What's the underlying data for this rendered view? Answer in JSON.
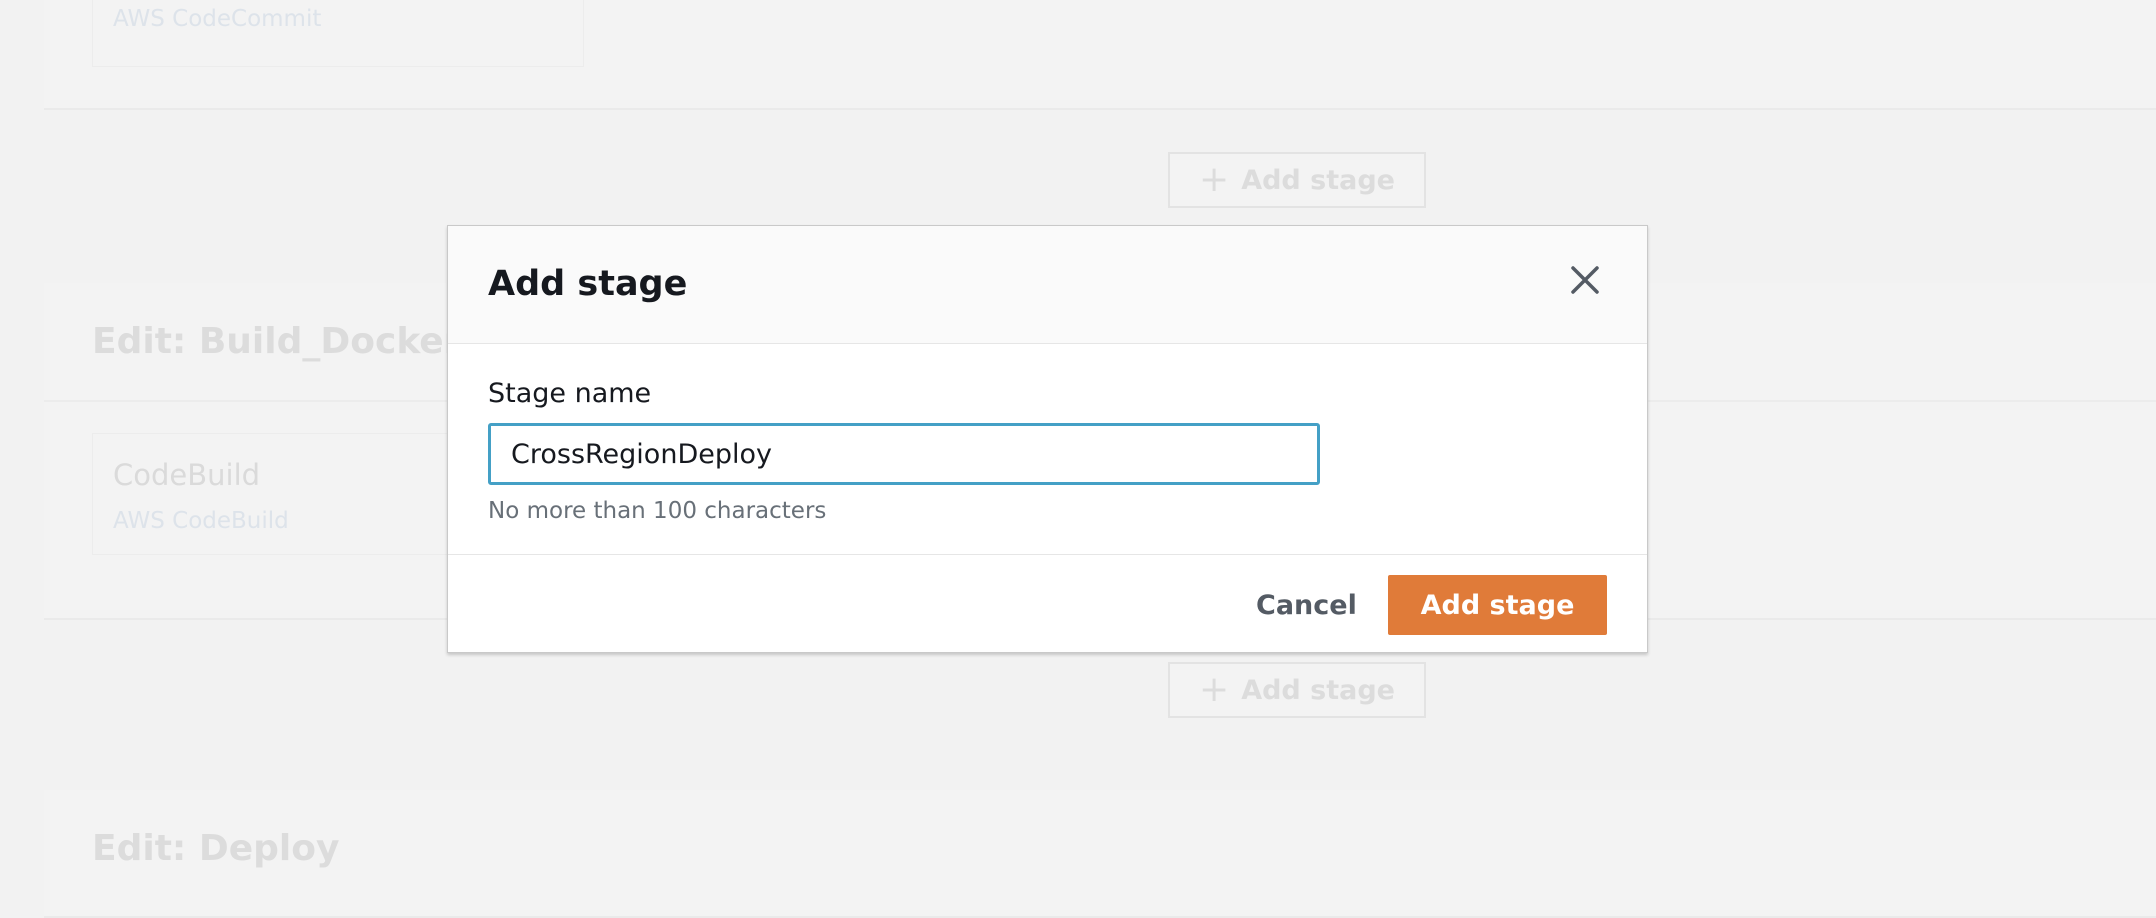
{
  "background": {
    "source_stage": {
      "action_provider": "AWS CodeCommit"
    },
    "add_stage_button_1": {
      "label": "Add stage",
      "icon": "plus-icon"
    },
    "build_stage": {
      "title": "Edit: Build_Docker_Co",
      "action_name": "CodeBuild",
      "action_provider": "AWS CodeBuild"
    },
    "add_stage_button_2": {
      "label": "Add stage",
      "icon": "plus-icon"
    },
    "deploy_stage": {
      "title": "Edit: Deploy"
    }
  },
  "modal": {
    "title": "Add stage",
    "close_icon": "close-icon",
    "field_label": "Stage name",
    "input_value": "CrossRegionDeploy",
    "hint": "No more than 100 characters",
    "cancel_label": "Cancel",
    "submit_label": "Add stage"
  },
  "colors": {
    "primary": "#e07b39",
    "focus_border": "#44a0c6",
    "title_text": "#16191f",
    "muted_text": "#687078"
  }
}
